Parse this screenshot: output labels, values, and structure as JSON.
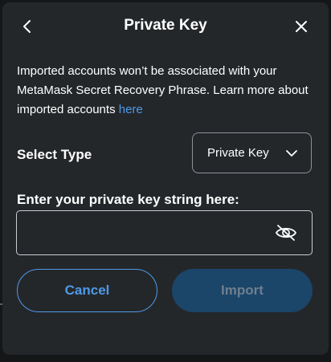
{
  "header": {
    "title": "Private Key",
    "back_icon": "chevron-left-icon",
    "close_icon": "close-icon"
  },
  "description": {
    "text": "Imported accounts won’t be associated with your MetaMask Secret Recovery Phrase. Learn more about imported accounts ",
    "link_text": "here"
  },
  "select_type": {
    "label": "Select Type",
    "selected_value": "Private Key",
    "icon": "chevron-down-icon"
  },
  "private_key": {
    "label": "Enter your private key string here:",
    "value": "",
    "placeholder": "",
    "visibility_icon": "eye-slash-icon"
  },
  "actions": {
    "cancel_label": "Cancel",
    "import_label": "Import"
  },
  "colors": {
    "background": "#24272a",
    "accent": "#4d9ae8",
    "import_disabled_bg": "#1b4569",
    "text": "#ffffff"
  }
}
